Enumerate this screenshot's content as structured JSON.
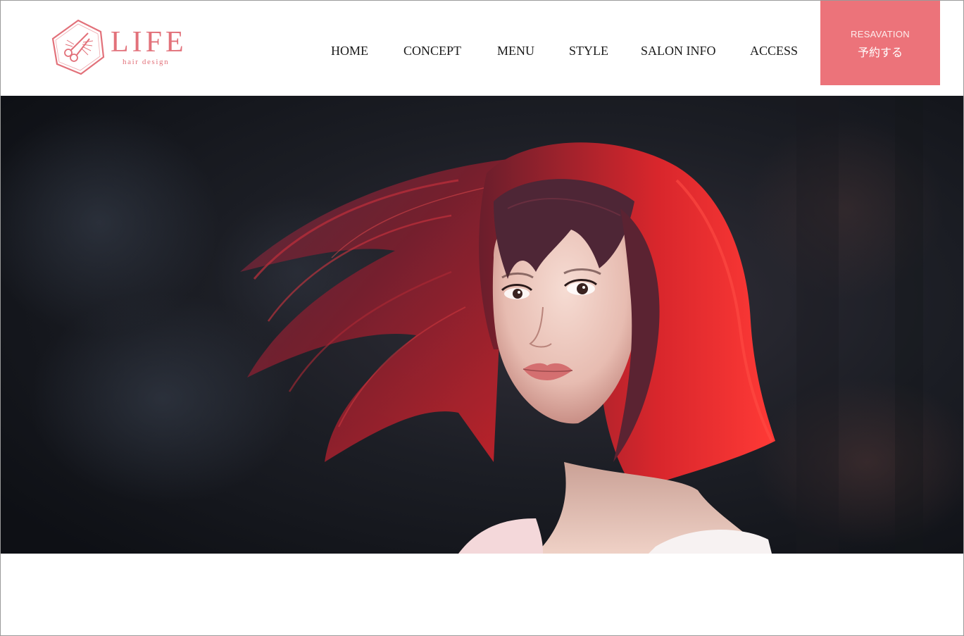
{
  "brand": {
    "name": "LIFE",
    "tagline": "hair design",
    "accent_color": "#e2717a"
  },
  "nav": {
    "items": [
      {
        "label": "HOME"
      },
      {
        "label": "CONCEPT"
      },
      {
        "label": "MENU"
      },
      {
        "label": "STYLE"
      },
      {
        "label": "SALON INFO"
      },
      {
        "label": "ACCESS"
      }
    ]
  },
  "reservation": {
    "label_en": "RESAVATION",
    "label_jp": "予約する",
    "bg_color": "#ec737a"
  },
  "hero": {
    "image": "hero-photo-woman-red-hair"
  }
}
